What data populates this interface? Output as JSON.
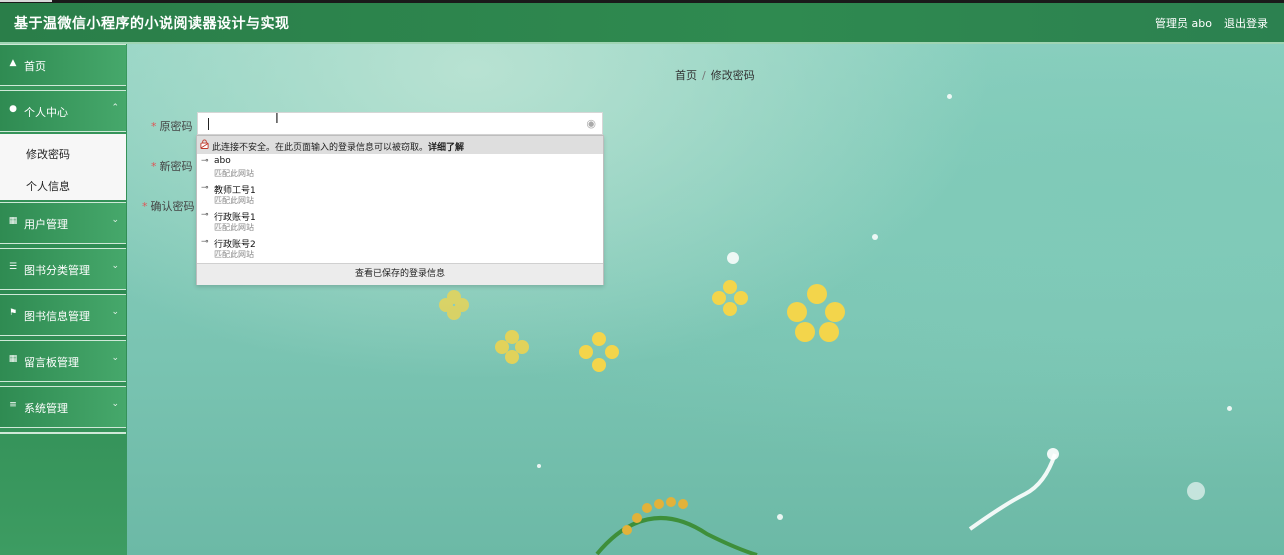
{
  "header": {
    "title": "基于温微信小程序的小说阅读器设计与实现",
    "user_label": "管理员 abo",
    "logout_label": "退出登录"
  },
  "sidebar": {
    "items": [
      {
        "label": "首页",
        "icon": "home-icon"
      },
      {
        "label": "个人中心",
        "icon": "person-icon",
        "expanded": true,
        "children": [
          {
            "label": "修改密码"
          },
          {
            "label": "个人信息"
          }
        ]
      },
      {
        "label": "用户管理",
        "icon": "grid-icon"
      },
      {
        "label": "图书分类管理",
        "icon": "list-icon"
      },
      {
        "label": "图书信息管理",
        "icon": "flag-icon"
      },
      {
        "label": "留言板管理",
        "icon": "grid-icon"
      },
      {
        "label": "系统管理",
        "icon": "settings-icon"
      }
    ]
  },
  "breadcrumb": {
    "home": "首页",
    "separator": "/",
    "current": "修改密码"
  },
  "form": {
    "fields": [
      {
        "label": "原密码",
        "required": true
      },
      {
        "label": "新密码",
        "required": true
      },
      {
        "label": "确认密码",
        "required": true
      }
    ]
  },
  "autofill": {
    "warning": "此连接不安全。在此页面输入的登录信息可以被窃取。",
    "learn_more": "详细了解",
    "entries": [
      {
        "name": "abo",
        "note": "匹配此网站"
      },
      {
        "name": "教师工号1",
        "note": "匹配此网站"
      },
      {
        "name": "行政账号1",
        "note": "匹配此网站"
      },
      {
        "name": "行政账号2",
        "note": "匹配此网站"
      }
    ],
    "footer": "查看已保存的登录信息"
  },
  "colors": {
    "header_green": "#2f8a50",
    "sidebar_green": "#3a9a5e",
    "required_star": "#e05555"
  }
}
